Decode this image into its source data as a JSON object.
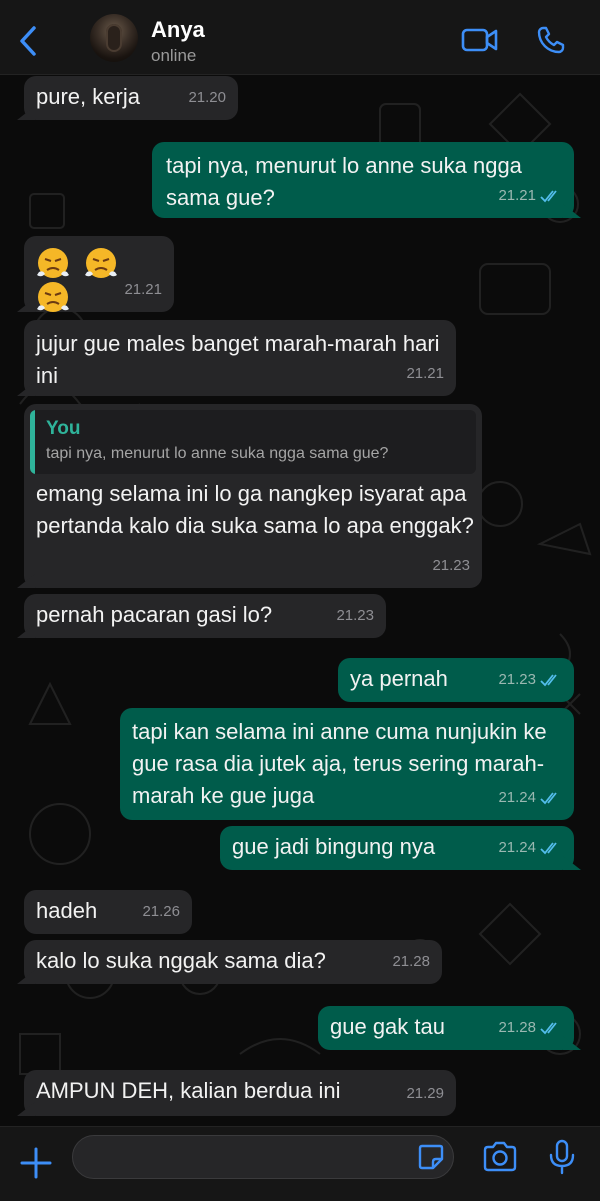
{
  "header": {
    "name": "Anya",
    "status": "online",
    "accent_color": "#3d8ef7"
  },
  "messages": [
    {
      "dir": "in",
      "text": "pure, kerja",
      "time": "21.20"
    },
    {
      "dir": "out",
      "text": "tapi nya, menurut lo anne suka ngga sama gue?",
      "time": "21.21",
      "read": true
    },
    {
      "dir": "in",
      "emoji": [
        "steam-face-emoji",
        "steam-face-emoji",
        "steam-face-emoji"
      ],
      "time": "21.21"
    },
    {
      "dir": "in",
      "text": "jujur gue males banget marah-marah hari ini",
      "time": "21.21"
    },
    {
      "dir": "in",
      "reply_to": {
        "name": "You",
        "text": "tapi nya, menurut lo anne suka ngga sama gue?"
      },
      "text": "emang selama ini lo ga nangkep isyarat apa pertanda kalo dia suka sama lo apa enggak?",
      "time": "21.23"
    },
    {
      "dir": "in",
      "text": "pernah pacaran gasi lo?",
      "time": "21.23"
    },
    {
      "dir": "out",
      "text": "ya pernah",
      "time": "21.23",
      "read": true
    },
    {
      "dir": "out",
      "text": "tapi kan selama ini anne cuma nunjukin ke gue rasa dia jutek aja, terus sering marah-marah ke gue juga",
      "time": "21.24",
      "read": true
    },
    {
      "dir": "out",
      "text": "gue jadi bingung nya",
      "time": "21.24",
      "read": true
    },
    {
      "dir": "in",
      "text": "hadeh",
      "time": "21.26"
    },
    {
      "dir": "in",
      "text": "kalo lo suka nggak sama dia?",
      "time": "21.28"
    },
    {
      "dir": "out",
      "text": "gue gak tau",
      "time": "21.28",
      "read": true
    },
    {
      "dir": "in",
      "text": "AMPUN DEH, kalian berdua ini",
      "time": "21.29"
    }
  ],
  "composer": {
    "placeholder": ""
  },
  "colors": {
    "incoming_bubble": "#262628",
    "outgoing_bubble": "#005c4b",
    "read_ticks": "#53bdeb",
    "reply_accent": "#2fb39a"
  }
}
